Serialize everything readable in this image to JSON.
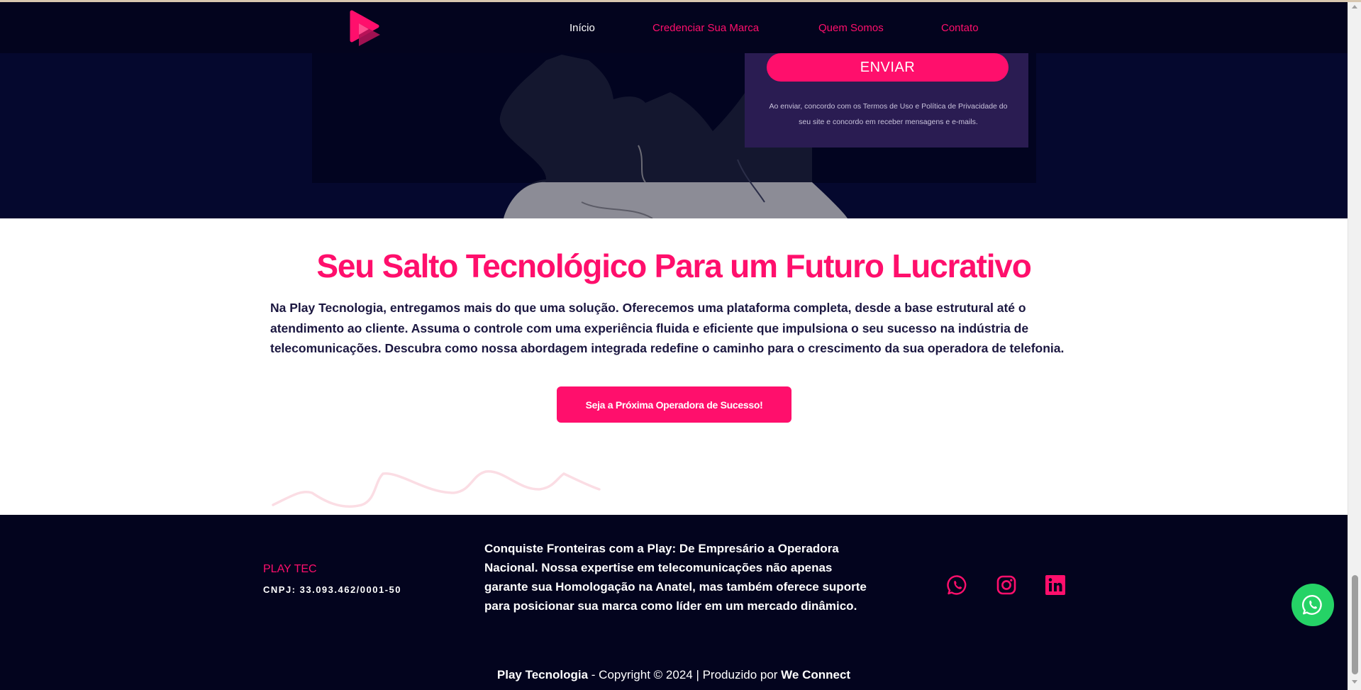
{
  "nav": {
    "logo": "play-logo-icon",
    "items": [
      {
        "label": "Início"
      },
      {
        "label": "Credenciar Sua Marca"
      },
      {
        "label": "Quem Somos"
      },
      {
        "label": "Contato"
      }
    ]
  },
  "form": {
    "submit_label": "ENVIAR",
    "disclaimer": "Ao enviar, concordo com os Termos de Uso e Política de Privacidade do seu site e concordo em receber mensagens e e-mails."
  },
  "main": {
    "title": "Seu Salto Tecnológico Para um Futuro Lucrativo",
    "paragraph": "Na Play Tecnologia, entregamos mais do que uma solução. Oferecemos uma plataforma completa, desde a base estrutural até o atendimento ao cliente. Assuma o controle com uma experiência fluida e eficiente que impulsiona o seu sucesso na indústria de telecomunicações. Descubra como nossa abordagem integrada redefine o caminho para o crescimento da sua operadora de telefonia.",
    "cta_label": "Seja a Próxima Operadora de Sucesso!"
  },
  "footer": {
    "brand": "PLAY TEC",
    "cnpj": "CNPJ: 33.093.462/0001-50",
    "tagline": "Conquiste Fronteiras com a Play: De Empresário a Operadora Nacional. Nossa expertise em telecomunicações não apenas garante sua Homologação na Anatel, mas também oferece suporte para posicionar sua marca como líder em um mercado dinâmico.",
    "social": [
      "whatsapp-icon",
      "instagram-icon",
      "linkedin-icon"
    ],
    "copyright": {
      "company": "Play Tecnologia",
      "middle": " - Copyright © 2024 | Produzido por ",
      "producer": "We Connect"
    }
  },
  "colors": {
    "accent": "#ff0f6c",
    "navy": "#03041e",
    "whatsapp": "#25d366"
  }
}
